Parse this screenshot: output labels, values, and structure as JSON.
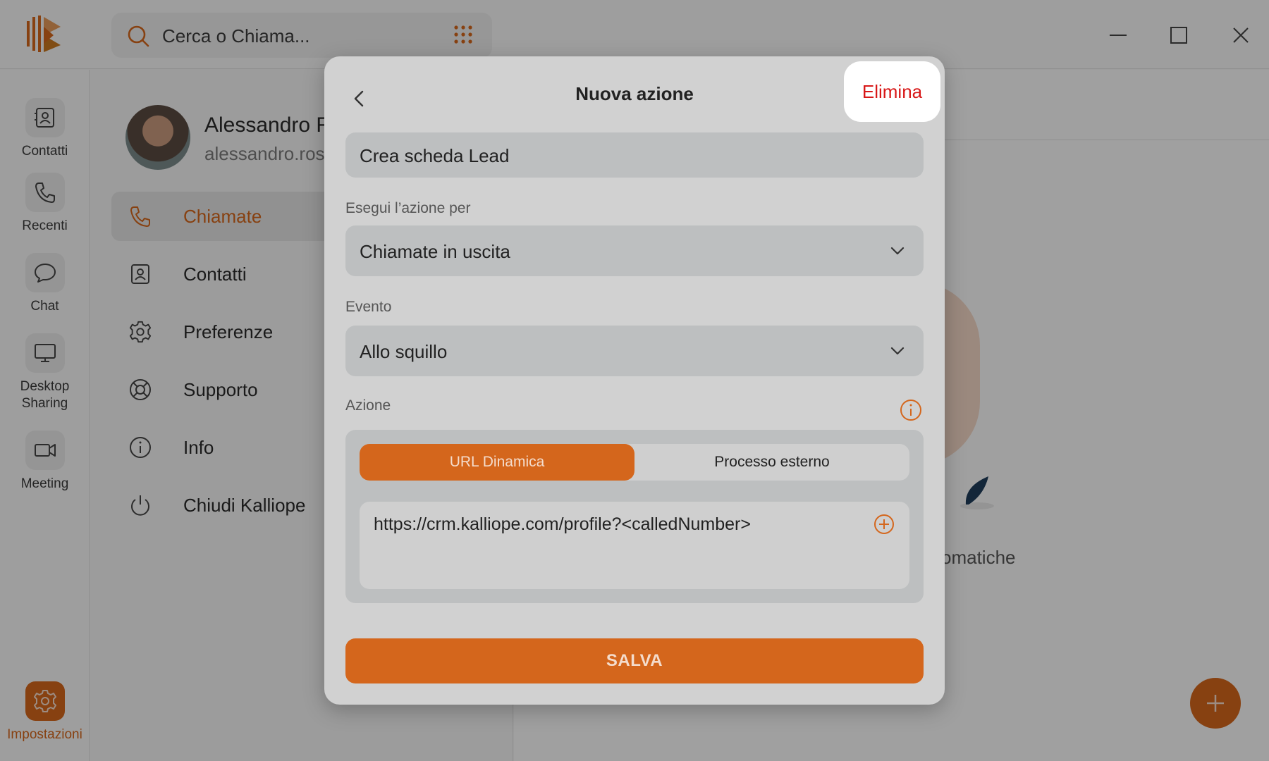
{
  "app": {
    "search_placeholder": "Cerca o Chiama..."
  },
  "rail": {
    "items": [
      {
        "label": "Contatti",
        "icon": "contacts-icon"
      },
      {
        "label": "Recenti",
        "icon": "phone-icon"
      },
      {
        "label": "Chat",
        "icon": "chat-icon"
      },
      {
        "label": "Desktop Sharing",
        "icon": "monitor-icon"
      },
      {
        "label": "Meeting",
        "icon": "video-icon"
      },
      {
        "label": "Impostazioni",
        "icon": "gear-icon"
      }
    ]
  },
  "profile": {
    "name": "Alessandro R",
    "email": "alessandro.ros"
  },
  "settings_menu": [
    {
      "label": "Chiamate",
      "icon": "phone-icon"
    },
    {
      "label": "Contatti",
      "icon": "contacts-icon"
    },
    {
      "label": "Preferenze",
      "icon": "gear-icon"
    },
    {
      "label": "Supporto",
      "icon": "lifebuoy-icon"
    },
    {
      "label": "Info",
      "icon": "info-icon"
    },
    {
      "label": "Chiudi Kalliope",
      "icon": "power-icon"
    }
  ],
  "background": {
    "partial_text": "omatiche"
  },
  "modal": {
    "title": "Nuova azione",
    "delete_label": "Elimina",
    "name_value": "Crea scheda Lead",
    "run_for_label": "Esegui l’azione per",
    "run_for_value": "Chiamate in uscita",
    "event_label": "Evento",
    "event_value": "Allo squillo",
    "action_label": "Azione",
    "segment_options": [
      "URL Dinamica",
      "Processo esterno"
    ],
    "url_value": "https://crm.kalliope.com/profile?<calledNumber>",
    "save_label": "SALVA"
  },
  "colors": {
    "accent": "#d4661c",
    "danger": "#d81818"
  }
}
